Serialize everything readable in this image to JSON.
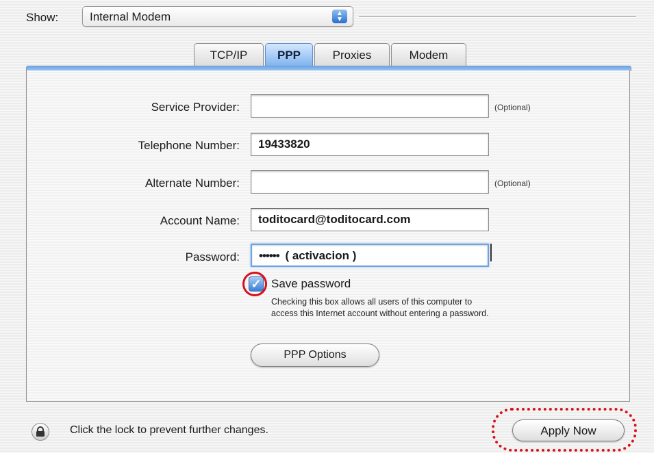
{
  "header": {
    "show_label": "Show:",
    "location_value": "Internal Modem"
  },
  "tabs": [
    {
      "label": "TCP/IP",
      "active": false
    },
    {
      "label": "PPP",
      "active": true
    },
    {
      "label": "Proxies",
      "active": false
    },
    {
      "label": "Modem",
      "active": false
    }
  ],
  "form": {
    "service_provider": {
      "label": "Service Provider:",
      "value": "",
      "note": "(Optional)"
    },
    "telephone": {
      "label": "Telephone Number:",
      "value": "19433820"
    },
    "alternate": {
      "label": "Alternate Number:",
      "value": "",
      "note": "(Optional)"
    },
    "account": {
      "label": "Account Name:",
      "value": "toditocard@toditocard.com"
    },
    "password": {
      "label": "Password:",
      "masked": "••••••",
      "hint": "( activacion )"
    }
  },
  "save_password": {
    "checked": true,
    "label": "Save password",
    "help_line1": "Checking this box allows all users of this computer to",
    "help_line2": "access this Internet account without entering a password."
  },
  "buttons": {
    "ppp_options": "PPP Options",
    "apply_now": "Apply Now"
  },
  "footer": {
    "lock_text": "Click the lock to prevent further changes."
  },
  "colors": {
    "highlight": "#d8101a",
    "tab_active": "#7fb3ee"
  }
}
